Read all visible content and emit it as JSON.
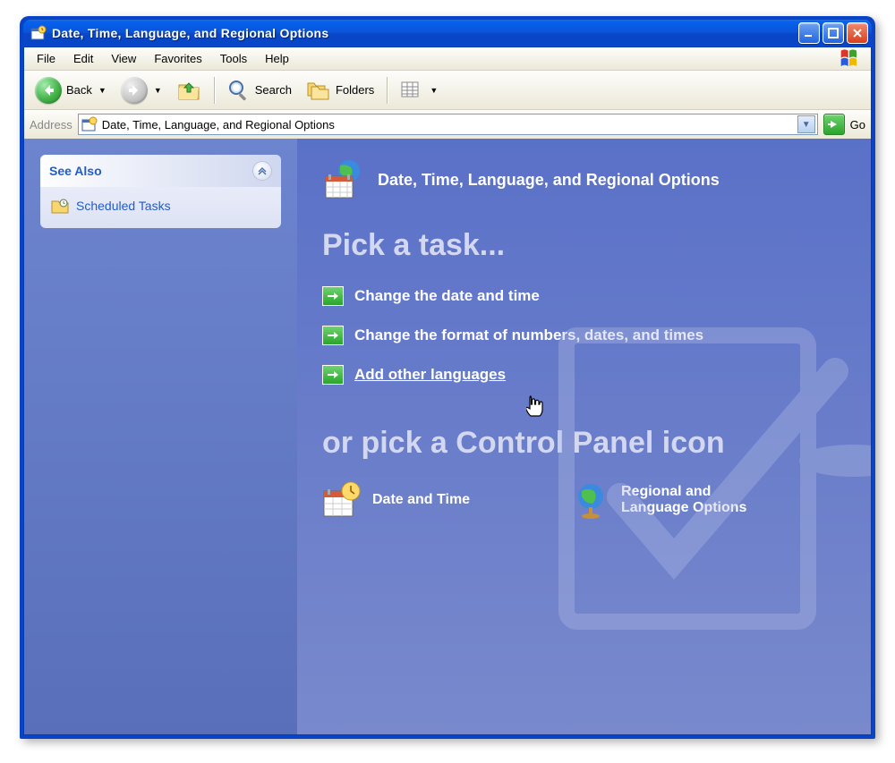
{
  "window": {
    "title": "Date, Time, Language, and Regional Options"
  },
  "menu": {
    "items": [
      "File",
      "Edit",
      "View",
      "Favorites",
      "Tools",
      "Help"
    ]
  },
  "toolbar": {
    "back": "Back",
    "search": "Search",
    "folders": "Folders"
  },
  "address": {
    "label": "Address",
    "value": "Date, Time, Language, and Regional Options",
    "go": "Go"
  },
  "sidebar": {
    "see_also_title": "See Also",
    "items": [
      {
        "label": "Scheduled Tasks"
      }
    ]
  },
  "main": {
    "header": "Date, Time, Language, and Regional Options",
    "pick_task": "Pick a task...",
    "tasks": [
      {
        "label": "Change the date and time"
      },
      {
        "label": "Change the format of numbers, dates, and times"
      },
      {
        "label": "Add other languages"
      }
    ],
    "pick_icon": "or pick a Control Panel icon",
    "icons": [
      {
        "label": "Date and Time"
      },
      {
        "label": "Regional and Language Options"
      }
    ]
  }
}
